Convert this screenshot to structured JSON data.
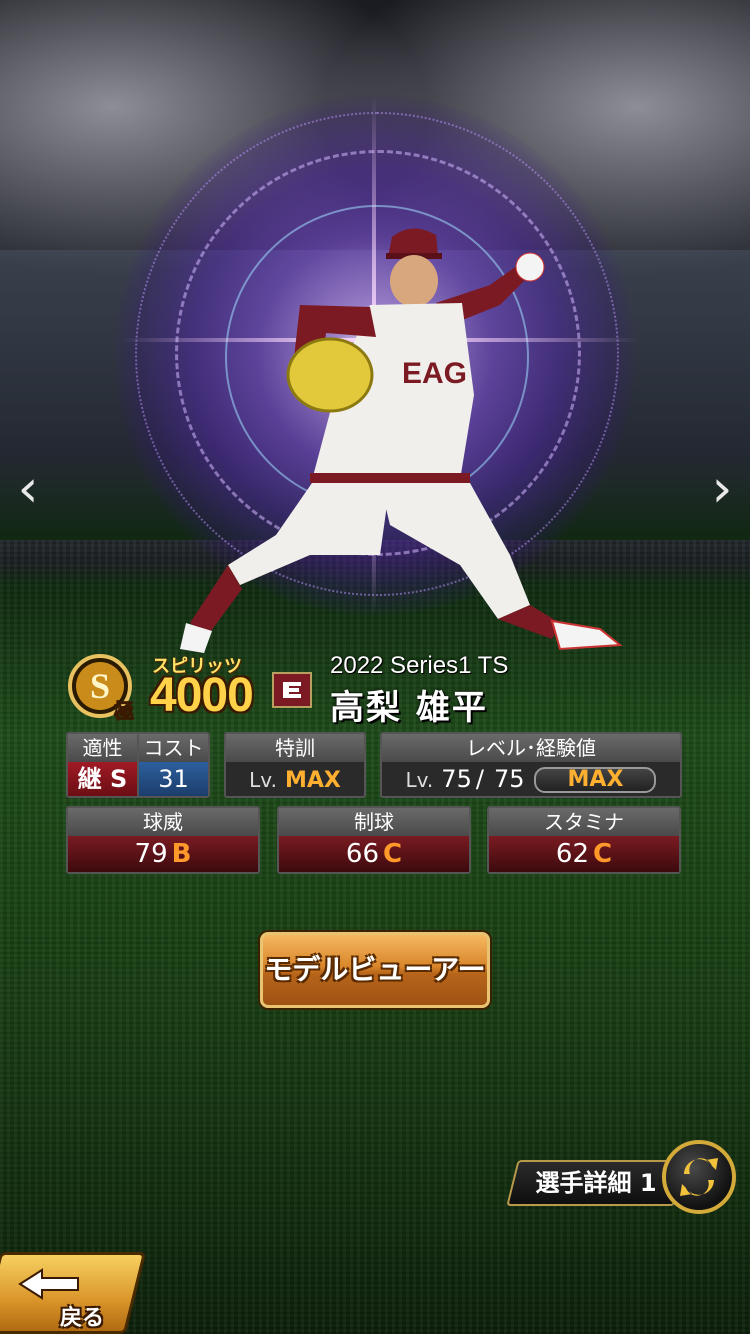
{
  "card": {
    "rank_letter": "S",
    "rank_sub": "極",
    "spirits_label": "スピリッツ",
    "spirits_value": "4000",
    "series": "2022 Series1 TS",
    "player_name": "高梨 雄平",
    "team_color": "#7b1a22"
  },
  "aptitude": {
    "header": "適性",
    "value": "継 S"
  },
  "cost": {
    "header": "コスト",
    "value": "31"
  },
  "training": {
    "header": "特訓",
    "lv_label": "Lv.",
    "value": "MAX"
  },
  "level": {
    "header": "レベル･経験値",
    "lv_label": "Lv.",
    "current": "75",
    "separator": "/",
    "max": "75",
    "exp_label": "MAX"
  },
  "stats": [
    {
      "header": "球威",
      "value": "79",
      "grade": "B"
    },
    {
      "header": "制球",
      "value": "66",
      "grade": "C"
    },
    {
      "header": "スタミナ",
      "value": "62",
      "grade": "C"
    }
  ],
  "buttons": {
    "model_viewer": "モデルビューアー",
    "player_detail": "選手詳細 1",
    "back": "戻る"
  },
  "icons": {
    "prev": "chevron-left-icon",
    "next": "chevron-right-icon",
    "swap": "swap-arrows-icon"
  }
}
